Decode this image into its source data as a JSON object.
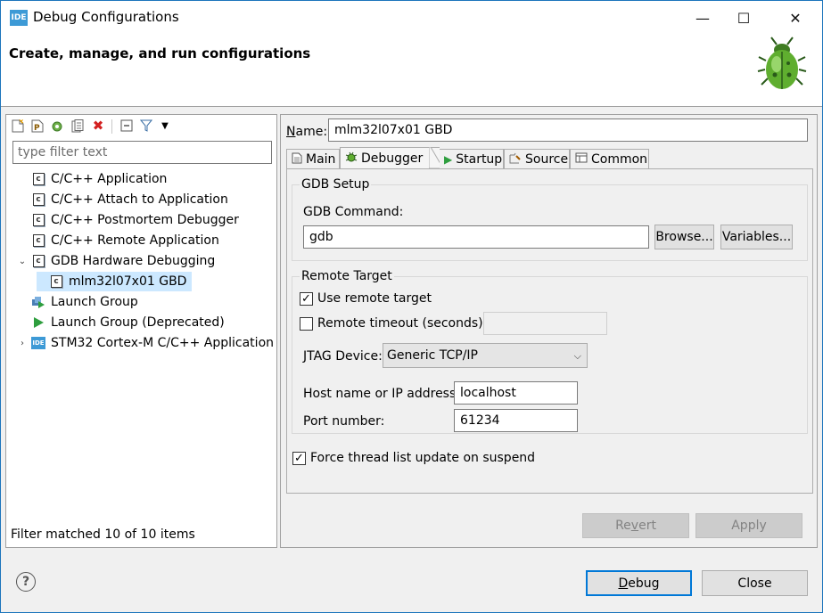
{
  "window": {
    "title": "Debug Configurations",
    "app_icon_text": "IDE",
    "minimize": "—",
    "maximize": "☐",
    "close": "✕"
  },
  "banner": {
    "title": "Create, manage, and run configurations",
    "icon": "bug-icon"
  },
  "left": {
    "toolbar": [
      "new-config-icon",
      "new-prototype-icon",
      "duplicate-icon",
      "export-icon",
      "delete-icon",
      "collapse-all-icon",
      "filter-icon",
      "view-menu-icon"
    ],
    "filter_placeholder": "type filter text",
    "tree": [
      {
        "label": "C/C++ Application",
        "icon": "c-app-icon"
      },
      {
        "label": "C/C++ Attach to Application",
        "icon": "c-app-icon"
      },
      {
        "label": "C/C++ Postmortem Debugger",
        "icon": "c-app-icon"
      },
      {
        "label": "C/C++ Remote Application",
        "icon": "c-app-icon"
      },
      {
        "label": "GDB Hardware Debugging",
        "icon": "c-app-icon",
        "expanded": true
      },
      {
        "label": "mlm32l07x01 GBD",
        "icon": "c-app-icon",
        "selected": true
      },
      {
        "label": "Launch Group",
        "icon": "launch-group-icon"
      },
      {
        "label": "Launch Group (Deprecated)",
        "icon": "launch-group-deprecated-icon"
      },
      {
        "label": "STM32 Cortex-M C/C++ Application",
        "icon": "stm32-ide-icon"
      }
    ],
    "stm32_icon_text": "IDE",
    "filter_status": "Filter matched 10 of 10 items"
  },
  "right": {
    "name_label_underlined": "N",
    "name_label_rest": "ame:",
    "name_value": "mlm32l07x01 GBD",
    "tabs": [
      {
        "label": "Main",
        "icon": "main-tab-icon"
      },
      {
        "label": "Debugger",
        "icon": "debugger-tab-icon"
      },
      {
        "label": "Startup",
        "icon": "startup-tab-icon"
      },
      {
        "label": "Source",
        "icon": "source-tab-icon"
      },
      {
        "label": "Common",
        "icon": "common-tab-icon"
      }
    ],
    "gdb_setup": {
      "title": "GDB Setup",
      "command_label": "GDB Command:",
      "command_value": "gdb",
      "browse": "Browse...",
      "variables": "Variables..."
    },
    "remote_target": {
      "title": "Remote Target",
      "use_remote_label": "Use remote target",
      "use_remote_checked": true,
      "timeout_label": "Remote timeout (seconds):",
      "timeout_checked": false,
      "timeout_value": "",
      "jtag_label": "JTAG Device:",
      "jtag_value": "Generic TCP/IP",
      "host_label": "Host name or IP address:",
      "host_value": "localhost",
      "port_label": "Port number:",
      "port_value": "61234"
    },
    "force_thread_label": "Force thread list update on suspend",
    "force_thread_checked": true,
    "revert": "Revert",
    "apply": "Apply"
  },
  "footer": {
    "help": "?",
    "debug": "Debug",
    "close": "Close"
  },
  "colors": {
    "accent": "#0078d7",
    "selection": "#cce8ff",
    "frame": "#1c75bc"
  }
}
